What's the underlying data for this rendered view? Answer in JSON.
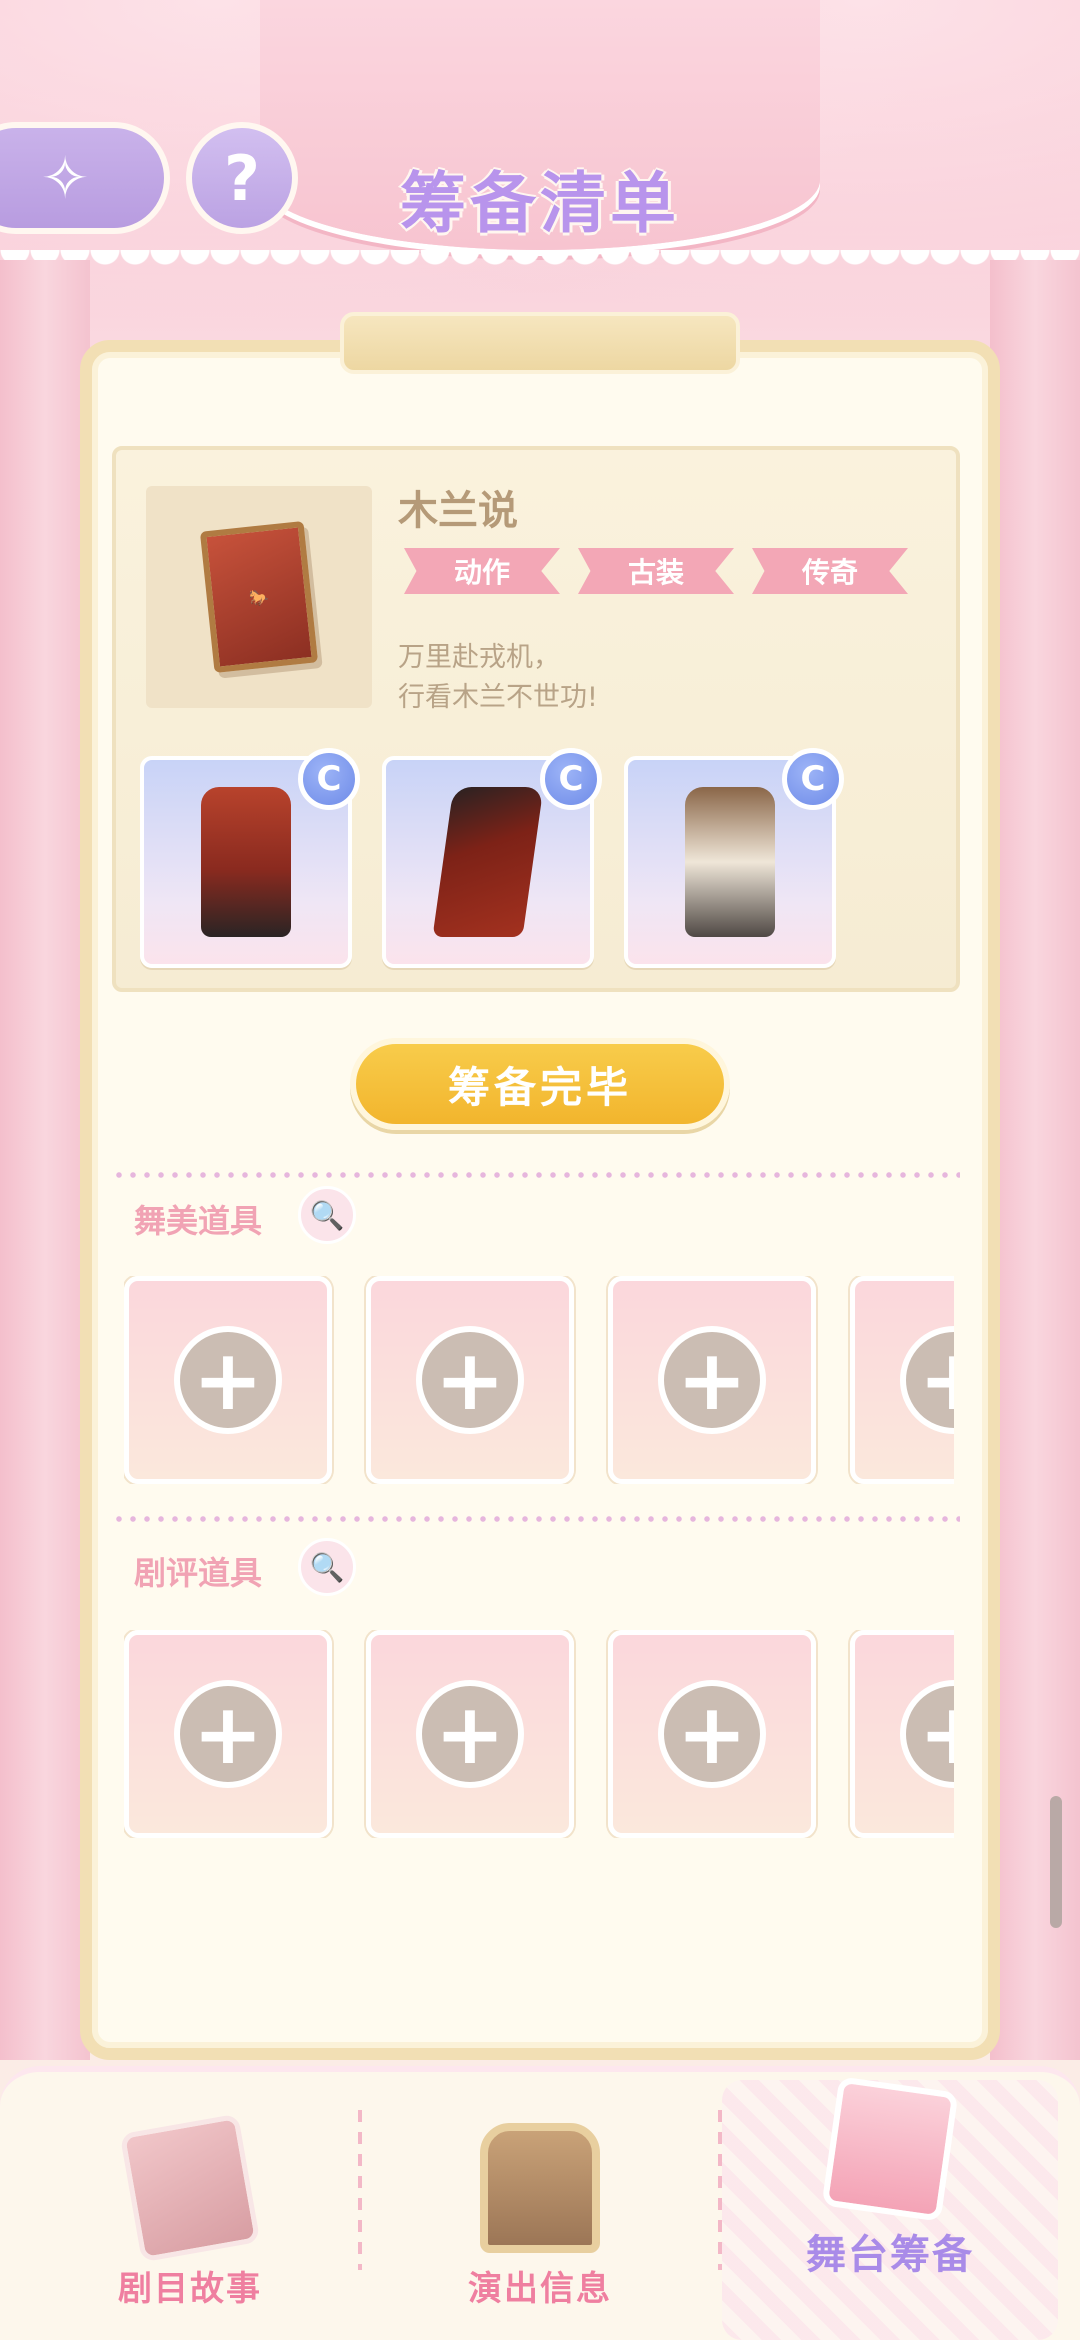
{
  "header": {
    "title": "筹备清单",
    "back_icon": "✧",
    "help_icon": "?"
  },
  "show": {
    "name": "木兰说",
    "tags": [
      "动作",
      "古装",
      "传奇"
    ],
    "description_line1": "万里赴戎机，",
    "description_line2": "行看木兰不世功!",
    "outfits": [
      {
        "rank": "C",
        "icon": "outfit-red-armor-icon"
      },
      {
        "rank": "C",
        "icon": "outfit-red-skirt-icon"
      },
      {
        "rank": "C",
        "icon": "outfit-brown-vest-icon"
      }
    ]
  },
  "confirm_button": "筹备完毕",
  "sections": {
    "stage_props": {
      "label": "舞美道具",
      "slot_count": 4
    },
    "review_props": {
      "label": "剧评道具",
      "slot_count": 4
    }
  },
  "plus_glyph": "+",
  "search_glyph": "🔍",
  "bottom_nav": {
    "items": [
      {
        "label": "剧目故事",
        "active": false
      },
      {
        "label": "演出信息",
        "active": false
      },
      {
        "label": "舞台筹备",
        "active": true
      }
    ]
  },
  "colors": {
    "title": "#b894ec",
    "tag": "#f3a7b6",
    "confirm": "#f2b52d",
    "section_label": "#f1a3b4",
    "nav_label": "#ef7fa0",
    "nav_active": "#a98be8"
  }
}
